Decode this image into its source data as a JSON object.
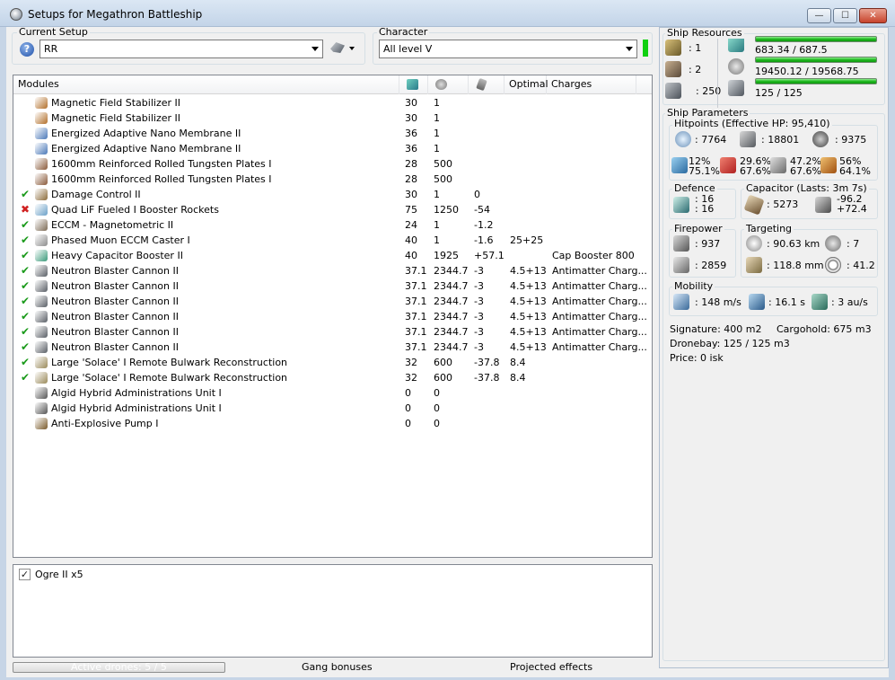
{
  "window": {
    "title": "Setups for Megathron Battleship",
    "min": "—",
    "max": "☐",
    "close": "✕"
  },
  "setup": {
    "label": "Current Setup",
    "value": "RR"
  },
  "character": {
    "label": "Character",
    "value": "All level V"
  },
  "modules": {
    "headers": {
      "name": "Modules",
      "optimal": "Optimal",
      "charges": "Charges"
    },
    "rows": [
      {
        "status": "",
        "name": "Magnetic Field Stabilizer II",
        "c1": "30",
        "c2": "1",
        "c3": "",
        "c4": "",
        "c5": "",
        "color": "#b26f2a"
      },
      {
        "status": "",
        "name": "Magnetic Field Stabilizer II",
        "c1": "30",
        "c2": "1",
        "c3": "",
        "c4": "",
        "c5": "",
        "color": "#b26f2a"
      },
      {
        "status": "",
        "name": "Energized Adaptive Nano Membrane II",
        "c1": "36",
        "c2": "1",
        "c3": "",
        "c4": "",
        "c5": "",
        "color": "#4a78b8"
      },
      {
        "status": "",
        "name": "Energized Adaptive Nano Membrane II",
        "c1": "36",
        "c2": "1",
        "c3": "",
        "c4": "",
        "c5": "",
        "color": "#4a78b8"
      },
      {
        "status": "",
        "name": "1600mm Reinforced Rolled Tungsten Plates I",
        "c1": "28",
        "c2": "500",
        "c3": "",
        "c4": "",
        "c5": "",
        "color": "#8a5a3a"
      },
      {
        "status": "",
        "name": "1600mm Reinforced Rolled Tungsten Plates I",
        "c1": "28",
        "c2": "500",
        "c3": "",
        "c4": "",
        "c5": "",
        "color": "#8a5a3a"
      },
      {
        "status": "✔",
        "name": "Damage Control II",
        "c1": "30",
        "c2": "1",
        "c3": "0",
        "c4": "",
        "c5": "",
        "color": "#8c6b3a"
      },
      {
        "status": "✖",
        "name": "Quad LiF Fueled I Booster Rockets",
        "c1": "75",
        "c2": "1250",
        "c3": "-54",
        "c4": "",
        "c5": "",
        "color": "#6aa0c8"
      },
      {
        "status": "✔",
        "name": "ECCM - Magnetometric II",
        "c1": "24",
        "c2": "1",
        "c3": "-1.2",
        "c4": "",
        "c5": "",
        "color": "#7c6a55"
      },
      {
        "status": "✔",
        "name": "Phased Muon ECCM Caster I",
        "c1": "40",
        "c2": "1",
        "c3": "-1.6",
        "c4": "25+25",
        "c5": "",
        "color": "#8c8c8c"
      },
      {
        "status": "✔",
        "name": "Heavy Capacitor Booster II",
        "c1": "40",
        "c2": "1925",
        "c3": "+57.1",
        "c4": "",
        "c5": "Cap Booster 800",
        "color": "#3a9a7a"
      },
      {
        "status": "✔",
        "name": "Neutron Blaster Cannon II",
        "c1": "37.1",
        "c2": "2344.7",
        "c3": "-3",
        "c4": "4.5+13",
        "c5": "Antimatter Charg...",
        "color": "#5a5f66"
      },
      {
        "status": "✔",
        "name": "Neutron Blaster Cannon II",
        "c1": "37.1",
        "c2": "2344.7",
        "c3": "-3",
        "c4": "4.5+13",
        "c5": "Antimatter Charg...",
        "color": "#5a5f66"
      },
      {
        "status": "✔",
        "name": "Neutron Blaster Cannon II",
        "c1": "37.1",
        "c2": "2344.7",
        "c3": "-3",
        "c4": "4.5+13",
        "c5": "Antimatter Charg...",
        "color": "#5a5f66"
      },
      {
        "status": "✔",
        "name": "Neutron Blaster Cannon II",
        "c1": "37.1",
        "c2": "2344.7",
        "c3": "-3",
        "c4": "4.5+13",
        "c5": "Antimatter Charg...",
        "color": "#5a5f66"
      },
      {
        "status": "✔",
        "name": "Neutron Blaster Cannon II",
        "c1": "37.1",
        "c2": "2344.7",
        "c3": "-3",
        "c4": "4.5+13",
        "c5": "Antimatter Charg...",
        "color": "#5a5f66"
      },
      {
        "status": "✔",
        "name": "Neutron Blaster Cannon II",
        "c1": "37.1",
        "c2": "2344.7",
        "c3": "-3",
        "c4": "4.5+13",
        "c5": "Antimatter Charg...",
        "color": "#5a5f66"
      },
      {
        "status": "✔",
        "name": "Large 'Solace' I Remote Bulwark Reconstruction",
        "c1": "32",
        "c2": "600",
        "c3": "-37.8",
        "c4": "8.4",
        "c5": "",
        "color": "#9a8a5a"
      },
      {
        "status": "✔",
        "name": "Large 'Solace' I Remote Bulwark Reconstruction",
        "c1": "32",
        "c2": "600",
        "c3": "-37.8",
        "c4": "8.4",
        "c5": "",
        "color": "#9a8a5a"
      },
      {
        "status": "",
        "name": "Algid Hybrid Administrations Unit I",
        "c1": "0",
        "c2": "0",
        "c3": "",
        "c4": "",
        "c5": "",
        "color": "#555555"
      },
      {
        "status": "",
        "name": "Algid Hybrid Administrations Unit I",
        "c1": "0",
        "c2": "0",
        "c3": "",
        "c4": "",
        "c5": "",
        "color": "#555555"
      },
      {
        "status": "",
        "name": "Anti-Explosive Pump I",
        "c1": "0",
        "c2": "0",
        "c3": "",
        "c4": "",
        "c5": "",
        "color": "#7a5a2a"
      }
    ]
  },
  "drones": {
    "checked": "✓",
    "item": "Ogre II x5"
  },
  "status": {
    "active_drones": "Active drones: 5 / 5",
    "gang": "Gang bonuses",
    "projected": "Projected effects"
  },
  "resources": {
    "label": "Ship Resources",
    "turrets": ": 1",
    "launchers": ": 2",
    "calibration": ": 250",
    "cpu": "683.34 / 687.5",
    "cpu_level": 0.994,
    "power": "19450.12 / 19568.75",
    "power_level": 0.994,
    "bandwidth": "125 / 125",
    "bandwidth_level": 1.0
  },
  "params": {
    "label": "Ship Parameters",
    "hitpoints": {
      "label": "Hitpoints (Effective HP: 95,410)",
      "shield": ": 7764",
      "armor": ": 18801",
      "structure": ": 9375",
      "em": "12%\n75.1%",
      "thermal": "29.6%\n67.6%",
      "kinetic": "47.2%\n67.6%",
      "explosive": "56%\n64.1%"
    },
    "defence": {
      "label": "Defence",
      "value": ": 16\n: 16"
    },
    "capacitor": {
      "label": "Capacitor (Lasts: 3m 7s)",
      "amount": ": 5273",
      "delta": "-96.2\n+72.4"
    },
    "firepower": {
      "label": "Firepower",
      "dps": ": 937",
      "volley": ": 2859"
    },
    "targeting": {
      "label": "Targeting",
      "range": ": 90.63 km",
      "targets": ": 7",
      "scan": ": 118.8 mm",
      "sensor": ": 41.2"
    },
    "mobility": {
      "label": "Mobility",
      "speed": ": 148 m/s",
      "align": ": 16.1 s",
      "warp": ": 3 au/s"
    },
    "signature": "Signature: 400 m2",
    "cargohold": "Cargohold: 675 m3",
    "dronebay": "Dronebay: 125 / 125 m3",
    "price": "Price: 0 isk"
  },
  "colors": {
    "ok": "#1a9a1a",
    "error": "#d02020",
    "bar": "#1fb81f",
    "char_status": "#10d010"
  }
}
